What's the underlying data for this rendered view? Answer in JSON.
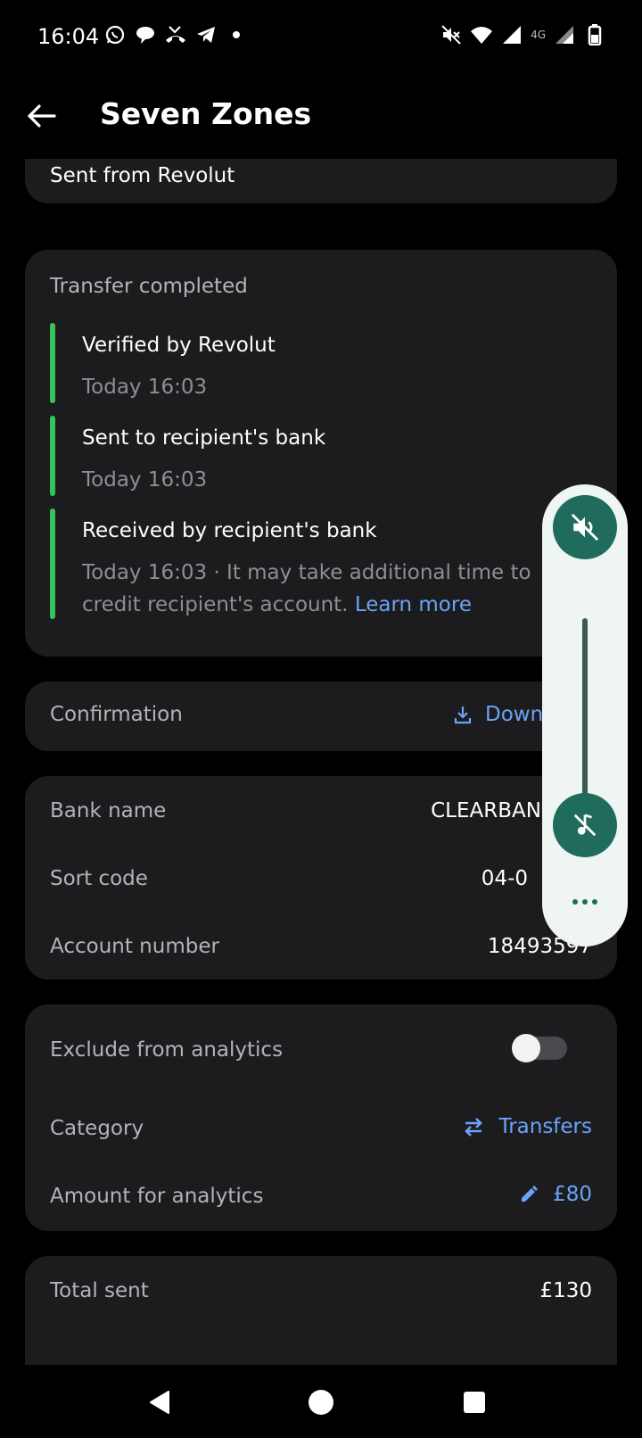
{
  "status_bar": {
    "time": "16:04",
    "left_icons": [
      "whatsapp-icon",
      "chat-icon",
      "missed-call-icon",
      "telegram-icon",
      "dot-icon"
    ],
    "right_icons": [
      "mute-icon",
      "wifi-icon",
      "signal-icon",
      "signal-icon",
      "battery-icon"
    ],
    "network_label": "4G"
  },
  "header": {
    "title": "Seven Zones"
  },
  "sent_card": {
    "text": "Sent from Revolut"
  },
  "timeline": {
    "heading": "Transfer completed",
    "steps": [
      {
        "title": "Verified by Revolut",
        "sub": "Today 16:03"
      },
      {
        "title": "Sent to recipient's bank",
        "sub": "Today 16:03"
      },
      {
        "title": "Received by recipient's bank",
        "sub": "Today 16:03 · It may take additional time to credit recipient's account.",
        "link": "Learn more"
      }
    ]
  },
  "confirmation": {
    "label": "Confirmation",
    "action": "Down"
  },
  "bank": {
    "rows": [
      {
        "label": "Bank name",
        "value": "CLEARBANK"
      },
      {
        "label": "Sort code",
        "value": "04-0"
      },
      {
        "label": "Account number",
        "value": "18493597"
      }
    ]
  },
  "analytics": {
    "exclude_label": "Exclude from analytics",
    "exclude_on": false,
    "category_label": "Category",
    "category_value": "Transfers",
    "amount_label": "Amount for analytics",
    "amount_value": "£80"
  },
  "total": {
    "label": "Total sent",
    "value": "£130"
  },
  "colors": {
    "accent": "#6aa3f7",
    "success": "#36c45a",
    "card": "#1c1c1e",
    "volume_accent": "#1f6b5c"
  }
}
